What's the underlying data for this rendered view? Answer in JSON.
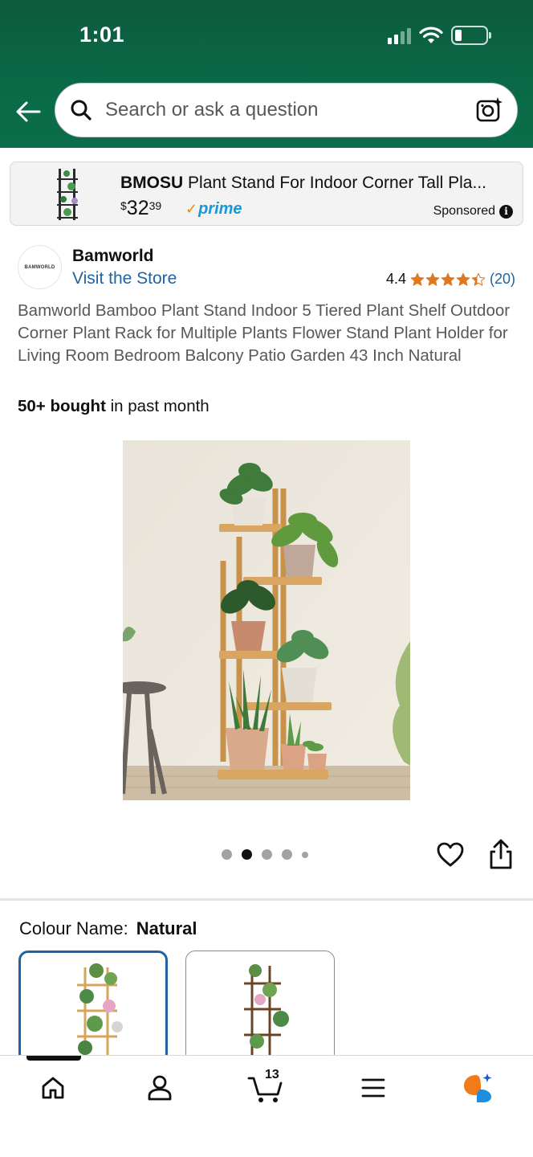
{
  "status_bar": {
    "time": "1:01"
  },
  "search": {
    "placeholder": "Search or ask a question"
  },
  "sponsored_ad": {
    "brand": "BMOSU",
    "title": "Plant Stand For Indoor Corner Tall Pla...",
    "price_symbol": "$",
    "price_whole": "32",
    "price_fraction": "39",
    "prime_label": "prime",
    "sponsored_label": "Sponsored",
    "info_symbol": "i"
  },
  "brand": {
    "logo_text": "BAMWORLD",
    "name": "Bamworld",
    "store_link": "Visit the Store"
  },
  "rating": {
    "value": "4.4",
    "stars": 4.4,
    "count": "(20)"
  },
  "product": {
    "title": "Bamworld Bamboo Plant Stand Indoor 5 Tiered Plant Shelf Outdoor Corner Plant Rack for Multiple Plants Flower Stand Plant Holder for Living Room Bedroom Balcony Patio Garden 43 Inch Natural",
    "bought_bold": "50+ bought",
    "bought_rest": " in past month"
  },
  "carousel": {
    "total_dots": 5,
    "active_index": 1
  },
  "colour": {
    "label": "Colour Name:",
    "value": "Natural",
    "options": [
      "Natural",
      "Brown"
    ]
  },
  "bottom_nav": {
    "items": [
      "home-icon",
      "account-icon",
      "cart-icon",
      "menu-icon",
      "rufus-icon"
    ],
    "cart_count": "13"
  },
  "colors": {
    "header_green": "#0a6a48",
    "link_blue": "#2162a1",
    "star_orange": "#de7921",
    "prime_blue": "#1a98d5"
  }
}
